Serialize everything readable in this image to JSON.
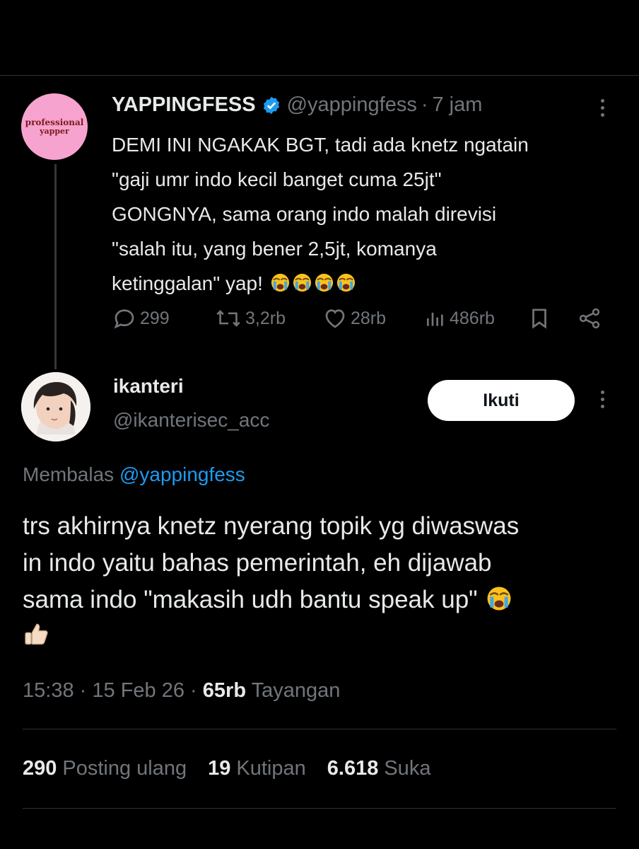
{
  "parent_tweet": {
    "avatar_text": [
      "professional",
      "yapper"
    ],
    "display_name": "YAPPINGFESS",
    "handle": "@yappingfess",
    "separator": "·",
    "time": "7 jam",
    "text_lines": [
      "DEMI INI NGAKAK BGT, tadi ada knetz ngatain",
      "\"gaji umr indo kecil banget cuma 25jt\"",
      "GONGNYA, sama orang indo malah direvisi",
      "\"salah itu, yang bener 2,5jt, komanya",
      "ketinggalan\" yap!"
    ],
    "emoji": [
      "loudly-crying-face",
      "loudly-crying-face",
      "loudly-crying-face",
      "loudly-crying-face"
    ],
    "actions": {
      "replies": "299",
      "reposts": "3,2rb",
      "likes": "28rb",
      "views": "486rb"
    }
  },
  "reply_tweet": {
    "display_name": "ikanteri",
    "handle": "@ikanterisec_acc",
    "follow_label": "Ikuti",
    "replying_prefix": "Membalas",
    "replying_to": "@yappingfess",
    "text_lines": [
      "trs akhirnya knetz nyerang topik yg diwaswas",
      "in indo yaitu bahas pemerintah, eh dijawab",
      "sama indo \"makasih udh bantu speak up\""
    ],
    "emoji": [
      "loudly-crying-face",
      "thumbs-up"
    ],
    "time": "15:38",
    "date": "15 Feb 26",
    "separator": "·",
    "views_count": "65rb",
    "views_label": "Tayangan",
    "stats": [
      {
        "count": "290",
        "label": "Posting ulang"
      },
      {
        "count": "19",
        "label": "Kutipan"
      },
      {
        "count": "6.618",
        "label": "Suka"
      }
    ]
  },
  "colors": {
    "background": "#000000",
    "text": "#e7e9ea",
    "muted": "#71767b",
    "accent": "#1d9bf0",
    "avatar_pink": "#f7a3cf"
  }
}
